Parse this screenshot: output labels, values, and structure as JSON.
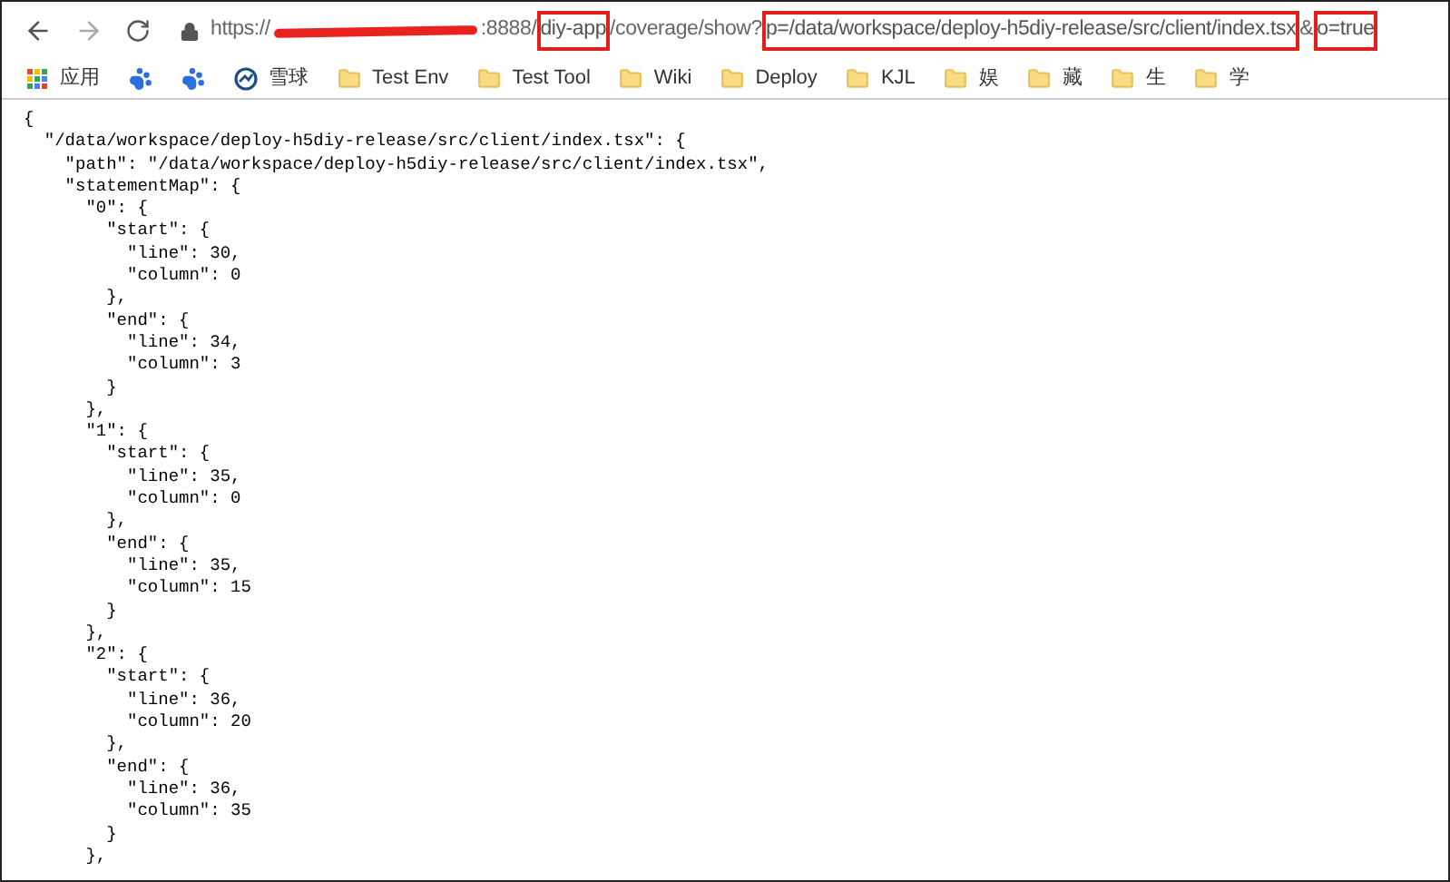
{
  "toolbar": {
    "url_segments": [
      {
        "kind": "text",
        "text": "https://",
        "highlighted": false
      },
      {
        "kind": "redacted"
      },
      {
        "kind": "text",
        "text": ":8888/",
        "highlighted": false
      },
      {
        "kind": "text",
        "text": "diy-app",
        "highlighted": true
      },
      {
        "kind": "text",
        "text": "/coverage/show?",
        "highlighted": false
      },
      {
        "kind": "text",
        "text": "p=/data/workspace/deploy-h5diy-release/src/client/index.tsx",
        "highlighted": true
      },
      {
        "kind": "text",
        "text": "&",
        "highlighted": false
      },
      {
        "kind": "text",
        "text": "o=true",
        "highlighted": true
      }
    ]
  },
  "bookmarks": [
    {
      "kind": "apps",
      "label": "应用"
    },
    {
      "kind": "paw"
    },
    {
      "kind": "paw"
    },
    {
      "kind": "logo",
      "label": "雪球"
    },
    {
      "kind": "folder",
      "label": "Test Env"
    },
    {
      "kind": "folder",
      "label": "Test Tool"
    },
    {
      "kind": "folder",
      "label": "Wiki"
    },
    {
      "kind": "folder",
      "label": "Deploy"
    },
    {
      "kind": "folder",
      "label": "KJL"
    },
    {
      "kind": "folder",
      "label": "娱"
    },
    {
      "kind": "folder",
      "label": "藏"
    },
    {
      "kind": "folder",
      "label": "生"
    },
    {
      "kind": "folder",
      "label": "学"
    }
  ],
  "code_lines": [
    "{",
    "  \"/data/workspace/deploy-h5diy-release/src/client/index.tsx\": {",
    "    \"path\": \"/data/workspace/deploy-h5diy-release/src/client/index.tsx\",",
    "    \"statementMap\": {",
    "      \"0\": {",
    "        \"start\": {",
    "          \"line\": 30,",
    "          \"column\": 0",
    "        },",
    "        \"end\": {",
    "          \"line\": 34,",
    "          \"column\": 3",
    "        }",
    "      },",
    "      \"1\": {",
    "        \"start\": {",
    "          \"line\": 35,",
    "          \"column\": 0",
    "        },",
    "        \"end\": {",
    "          \"line\": 35,",
    "          \"column\": 15",
    "        }",
    "      },",
    "      \"2\": {",
    "        \"start\": {",
    "          \"line\": 36,",
    "          \"column\": 20",
    "        },",
    "        \"end\": {",
    "          \"line\": 36,",
    "          \"column\": 35",
    "        }",
    "      },"
  ]
}
